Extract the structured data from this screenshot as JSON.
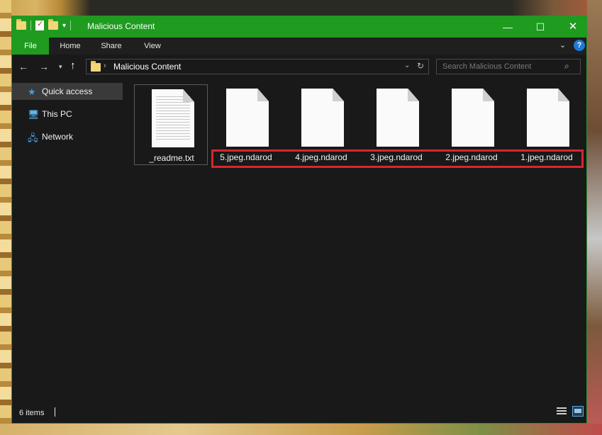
{
  "window": {
    "title": "Malicious Content",
    "controls": {
      "minimize": "—",
      "maximize": "☐",
      "close": "✕"
    }
  },
  "ribbon": {
    "tabs": [
      "File",
      "Home",
      "Share",
      "View"
    ],
    "help": "?"
  },
  "navigation": {
    "path": "Malicious Content",
    "search_placeholder": "Search Malicious Content"
  },
  "sidebar": {
    "items": [
      {
        "label": "Quick access",
        "icon": "star-icon"
      },
      {
        "label": "This PC",
        "icon": "computer-icon"
      },
      {
        "label": "Network",
        "icon": "network-icon"
      }
    ]
  },
  "files": [
    {
      "name": "_readme.txt",
      "type": "text-document"
    },
    {
      "name": "5.jpeg.ndarod",
      "type": "blank-document"
    },
    {
      "name": "4.jpeg.ndarod",
      "type": "blank-document"
    },
    {
      "name": "3.jpeg.ndarod",
      "type": "blank-document"
    },
    {
      "name": "2.jpeg.ndarod",
      "type": "blank-document"
    },
    {
      "name": "1.jpeg.ndarod",
      "type": "blank-document"
    }
  ],
  "status": {
    "item_count": "6 items"
  },
  "colors": {
    "titlebar": "#1f9b1f",
    "background": "#191919",
    "highlight_border": "#d9262d",
    "accent_blue": "#1e78d7"
  }
}
